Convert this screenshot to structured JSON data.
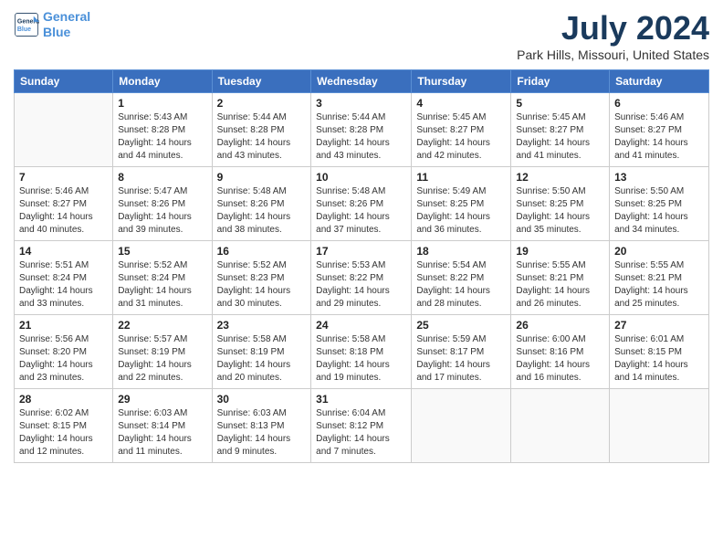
{
  "logo": {
    "line1": "General",
    "line2": "Blue"
  },
  "title": "July 2024",
  "location": "Park Hills, Missouri, United States",
  "days_of_week": [
    "Sunday",
    "Monday",
    "Tuesday",
    "Wednesday",
    "Thursday",
    "Friday",
    "Saturday"
  ],
  "weeks": [
    [
      {
        "day": "",
        "sunrise": "",
        "sunset": "",
        "daylight": ""
      },
      {
        "day": "1",
        "sunrise": "Sunrise: 5:43 AM",
        "sunset": "Sunset: 8:28 PM",
        "daylight": "Daylight: 14 hours and 44 minutes."
      },
      {
        "day": "2",
        "sunrise": "Sunrise: 5:44 AM",
        "sunset": "Sunset: 8:28 PM",
        "daylight": "Daylight: 14 hours and 43 minutes."
      },
      {
        "day": "3",
        "sunrise": "Sunrise: 5:44 AM",
        "sunset": "Sunset: 8:28 PM",
        "daylight": "Daylight: 14 hours and 43 minutes."
      },
      {
        "day": "4",
        "sunrise": "Sunrise: 5:45 AM",
        "sunset": "Sunset: 8:27 PM",
        "daylight": "Daylight: 14 hours and 42 minutes."
      },
      {
        "day": "5",
        "sunrise": "Sunrise: 5:45 AM",
        "sunset": "Sunset: 8:27 PM",
        "daylight": "Daylight: 14 hours and 41 minutes."
      },
      {
        "day": "6",
        "sunrise": "Sunrise: 5:46 AM",
        "sunset": "Sunset: 8:27 PM",
        "daylight": "Daylight: 14 hours and 41 minutes."
      }
    ],
    [
      {
        "day": "7",
        "sunrise": "Sunrise: 5:46 AM",
        "sunset": "Sunset: 8:27 PM",
        "daylight": "Daylight: 14 hours and 40 minutes."
      },
      {
        "day": "8",
        "sunrise": "Sunrise: 5:47 AM",
        "sunset": "Sunset: 8:26 PM",
        "daylight": "Daylight: 14 hours and 39 minutes."
      },
      {
        "day": "9",
        "sunrise": "Sunrise: 5:48 AM",
        "sunset": "Sunset: 8:26 PM",
        "daylight": "Daylight: 14 hours and 38 minutes."
      },
      {
        "day": "10",
        "sunrise": "Sunrise: 5:48 AM",
        "sunset": "Sunset: 8:26 PM",
        "daylight": "Daylight: 14 hours and 37 minutes."
      },
      {
        "day": "11",
        "sunrise": "Sunrise: 5:49 AM",
        "sunset": "Sunset: 8:25 PM",
        "daylight": "Daylight: 14 hours and 36 minutes."
      },
      {
        "day": "12",
        "sunrise": "Sunrise: 5:50 AM",
        "sunset": "Sunset: 8:25 PM",
        "daylight": "Daylight: 14 hours and 35 minutes."
      },
      {
        "day": "13",
        "sunrise": "Sunrise: 5:50 AM",
        "sunset": "Sunset: 8:25 PM",
        "daylight": "Daylight: 14 hours and 34 minutes."
      }
    ],
    [
      {
        "day": "14",
        "sunrise": "Sunrise: 5:51 AM",
        "sunset": "Sunset: 8:24 PM",
        "daylight": "Daylight: 14 hours and 33 minutes."
      },
      {
        "day": "15",
        "sunrise": "Sunrise: 5:52 AM",
        "sunset": "Sunset: 8:24 PM",
        "daylight": "Daylight: 14 hours and 31 minutes."
      },
      {
        "day": "16",
        "sunrise": "Sunrise: 5:52 AM",
        "sunset": "Sunset: 8:23 PM",
        "daylight": "Daylight: 14 hours and 30 minutes."
      },
      {
        "day": "17",
        "sunrise": "Sunrise: 5:53 AM",
        "sunset": "Sunset: 8:22 PM",
        "daylight": "Daylight: 14 hours and 29 minutes."
      },
      {
        "day": "18",
        "sunrise": "Sunrise: 5:54 AM",
        "sunset": "Sunset: 8:22 PM",
        "daylight": "Daylight: 14 hours and 28 minutes."
      },
      {
        "day": "19",
        "sunrise": "Sunrise: 5:55 AM",
        "sunset": "Sunset: 8:21 PM",
        "daylight": "Daylight: 14 hours and 26 minutes."
      },
      {
        "day": "20",
        "sunrise": "Sunrise: 5:55 AM",
        "sunset": "Sunset: 8:21 PM",
        "daylight": "Daylight: 14 hours and 25 minutes."
      }
    ],
    [
      {
        "day": "21",
        "sunrise": "Sunrise: 5:56 AM",
        "sunset": "Sunset: 8:20 PM",
        "daylight": "Daylight: 14 hours and 23 minutes."
      },
      {
        "day": "22",
        "sunrise": "Sunrise: 5:57 AM",
        "sunset": "Sunset: 8:19 PM",
        "daylight": "Daylight: 14 hours and 22 minutes."
      },
      {
        "day": "23",
        "sunrise": "Sunrise: 5:58 AM",
        "sunset": "Sunset: 8:19 PM",
        "daylight": "Daylight: 14 hours and 20 minutes."
      },
      {
        "day": "24",
        "sunrise": "Sunrise: 5:58 AM",
        "sunset": "Sunset: 8:18 PM",
        "daylight": "Daylight: 14 hours and 19 minutes."
      },
      {
        "day": "25",
        "sunrise": "Sunrise: 5:59 AM",
        "sunset": "Sunset: 8:17 PM",
        "daylight": "Daylight: 14 hours and 17 minutes."
      },
      {
        "day": "26",
        "sunrise": "Sunrise: 6:00 AM",
        "sunset": "Sunset: 8:16 PM",
        "daylight": "Daylight: 14 hours and 16 minutes."
      },
      {
        "day": "27",
        "sunrise": "Sunrise: 6:01 AM",
        "sunset": "Sunset: 8:15 PM",
        "daylight": "Daylight: 14 hours and 14 minutes."
      }
    ],
    [
      {
        "day": "28",
        "sunrise": "Sunrise: 6:02 AM",
        "sunset": "Sunset: 8:15 PM",
        "daylight": "Daylight: 14 hours and 12 minutes."
      },
      {
        "day": "29",
        "sunrise": "Sunrise: 6:03 AM",
        "sunset": "Sunset: 8:14 PM",
        "daylight": "Daylight: 14 hours and 11 minutes."
      },
      {
        "day": "30",
        "sunrise": "Sunrise: 6:03 AM",
        "sunset": "Sunset: 8:13 PM",
        "daylight": "Daylight: 14 hours and 9 minutes."
      },
      {
        "day": "31",
        "sunrise": "Sunrise: 6:04 AM",
        "sunset": "Sunset: 8:12 PM",
        "daylight": "Daylight: 14 hours and 7 minutes."
      },
      {
        "day": "",
        "sunrise": "",
        "sunset": "",
        "daylight": ""
      },
      {
        "day": "",
        "sunrise": "",
        "sunset": "",
        "daylight": ""
      },
      {
        "day": "",
        "sunrise": "",
        "sunset": "",
        "daylight": ""
      }
    ]
  ]
}
